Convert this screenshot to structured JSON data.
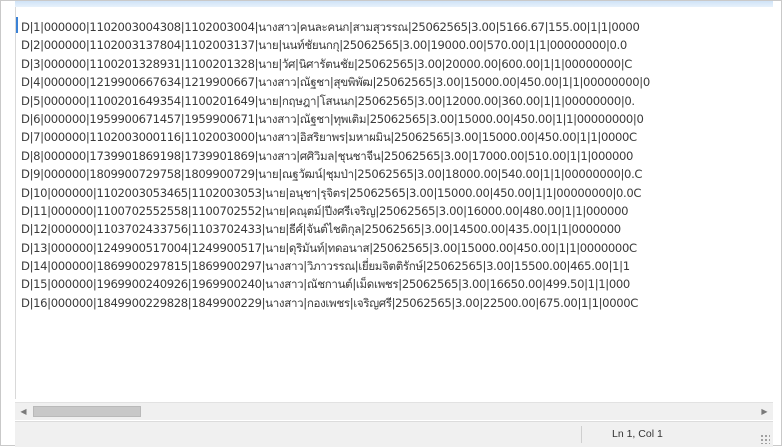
{
  "editor": {
    "lines": [
      "D|1|000000|1102003004308|1102003004|นางสาว|คนละคนก|สามสุวรรณ|25062565|3.00|5166.67|155.00|1|1|0000",
      "D|2|000000|1102003137804|1102003137|นาย|นนท์ชัยนกกุ|25062565|3.00|19000.00|570.00|1|1|00000000|0.0",
      "D|3|000000|1100201328931|1100201328|นาย|วัศ|นิศารัตนชัย|25062565|3.00|20000.00|600.00|1|1|00000000|C",
      "D|4|000000|1219900667634|1219900667|นางสาว|ณัฐชา|สุขพิพัฒ|25062565|3.00|15000.00|450.00|1|1|00000000|0",
      "D|5|000000|1100201649354|1100201649|นาย|กฤษฎา|โสนนก|25062565|3.00|12000.00|360.00|1|1|00000000|0.",
      "D|6|000000|1959900671457|1959900671|นางสาว|ณัฐชา|ทุพเติม|25062565|3.00|15000.00|450.00|1|1|00000000|0",
      "D|7|000000|1102003000116|1102003000|นางสาว|อิสริยาพร|มหาผมิน|25062565|3.00|15000.00|450.00|1|1|0000C",
      "D|8|000000|1739901869198|1739901869|นางสาว|ศศิวิมล|ชุนชาจีน|25062565|3.00|17000.00|510.00|1|1|000000",
      "D|9|000000|1809900729758|1809900729|นาย|ณฐวัฒน์|ชุมป่า|25062565|3.00|18000.00|540.00|1|1|00000000|0.C",
      "D|10|000000|1102003053465|1102003053|นาย|อนุชา|รุจิตร|25062565|3.00|15000.00|450.00|1|1|00000000|0.0C",
      "D|11|000000|1100702552558|1100702552|นาย|คณุตม์|ปีงศรีเจริญ|25062565|3.00|16000.00|480.00|1|1|000000",
      "D|12|000000|1103702433756|1103702433|นาย|ธีศ์|จันต์ไชติกุล|25062565|3.00|14500.00|435.00|1|1|0000000",
      "D|13|000000|1249900517004|1249900517|นาย|ดุริมันท์|ทดอนาส|25062565|3.00|15000.00|450.00|1|1|0000000C",
      "D|14|000000|1869900297815|1869900297|นางสาว|วิภาวรรณ|เยี่ยมจิตติรักษ์|25062565|3.00|15500.00|465.00|1|1",
      "D|15|000000|1969900240926|1969900240|นางสาว|ณัชกานต์|เม็ดเพชร|25062565|3.00|16650.00|499.50|1|1|000",
      "D|16|000000|1849900229828|1849900229|นางสาว|กองเพชร|เจริญศรี|25062565|3.00|22500.00|675.00|1|1|0000C"
    ]
  },
  "scrollbar": {
    "left_arrow": "◀",
    "right_arrow": "▶"
  },
  "status": {
    "position": "Ln 1, Col 1"
  }
}
